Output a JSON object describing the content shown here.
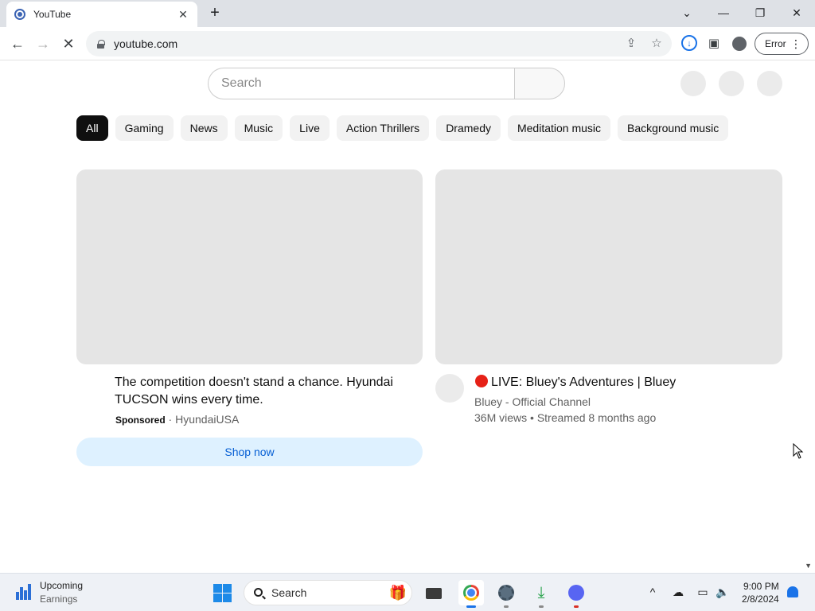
{
  "browser": {
    "tab": {
      "title": "YouTube",
      "close": "✕"
    },
    "new_tab": "+",
    "window_controls": {
      "tab_list": "⌄",
      "minimize": "—",
      "restore": "❐",
      "close": "✕"
    },
    "nav": {
      "back": "←",
      "forward": "→",
      "reload": "✕"
    },
    "url": "youtube.com",
    "profile_status": "Error"
  },
  "youtube": {
    "search_placeholder": "Search",
    "chips": [
      {
        "label": "All",
        "active": true
      },
      {
        "label": "Gaming"
      },
      {
        "label": "News"
      },
      {
        "label": "Music"
      },
      {
        "label": "Live"
      },
      {
        "label": "Action Thrillers"
      },
      {
        "label": "Dramedy"
      },
      {
        "label": "Meditation music"
      },
      {
        "label": "Background music"
      }
    ],
    "ad": {
      "title": "The competition doesn't stand a chance. Hyundai TUCSON wins every time.",
      "sponsored_label": "Sponsored",
      "separator": " · ",
      "advertiser": "HyundaiUSA",
      "cta": "Shop now"
    },
    "video": {
      "title": "LIVE: Bluey's Adventures | Bluey",
      "channel": "Bluey - Official Channel",
      "views": "36M views",
      "separator": " • ",
      "streamed": "Streamed 8 months ago"
    }
  },
  "taskbar": {
    "weather_title": "Upcoming",
    "weather_subtitle": "Earnings",
    "search_label": "Search",
    "time": "9:00 PM",
    "date": "2/8/2024"
  }
}
